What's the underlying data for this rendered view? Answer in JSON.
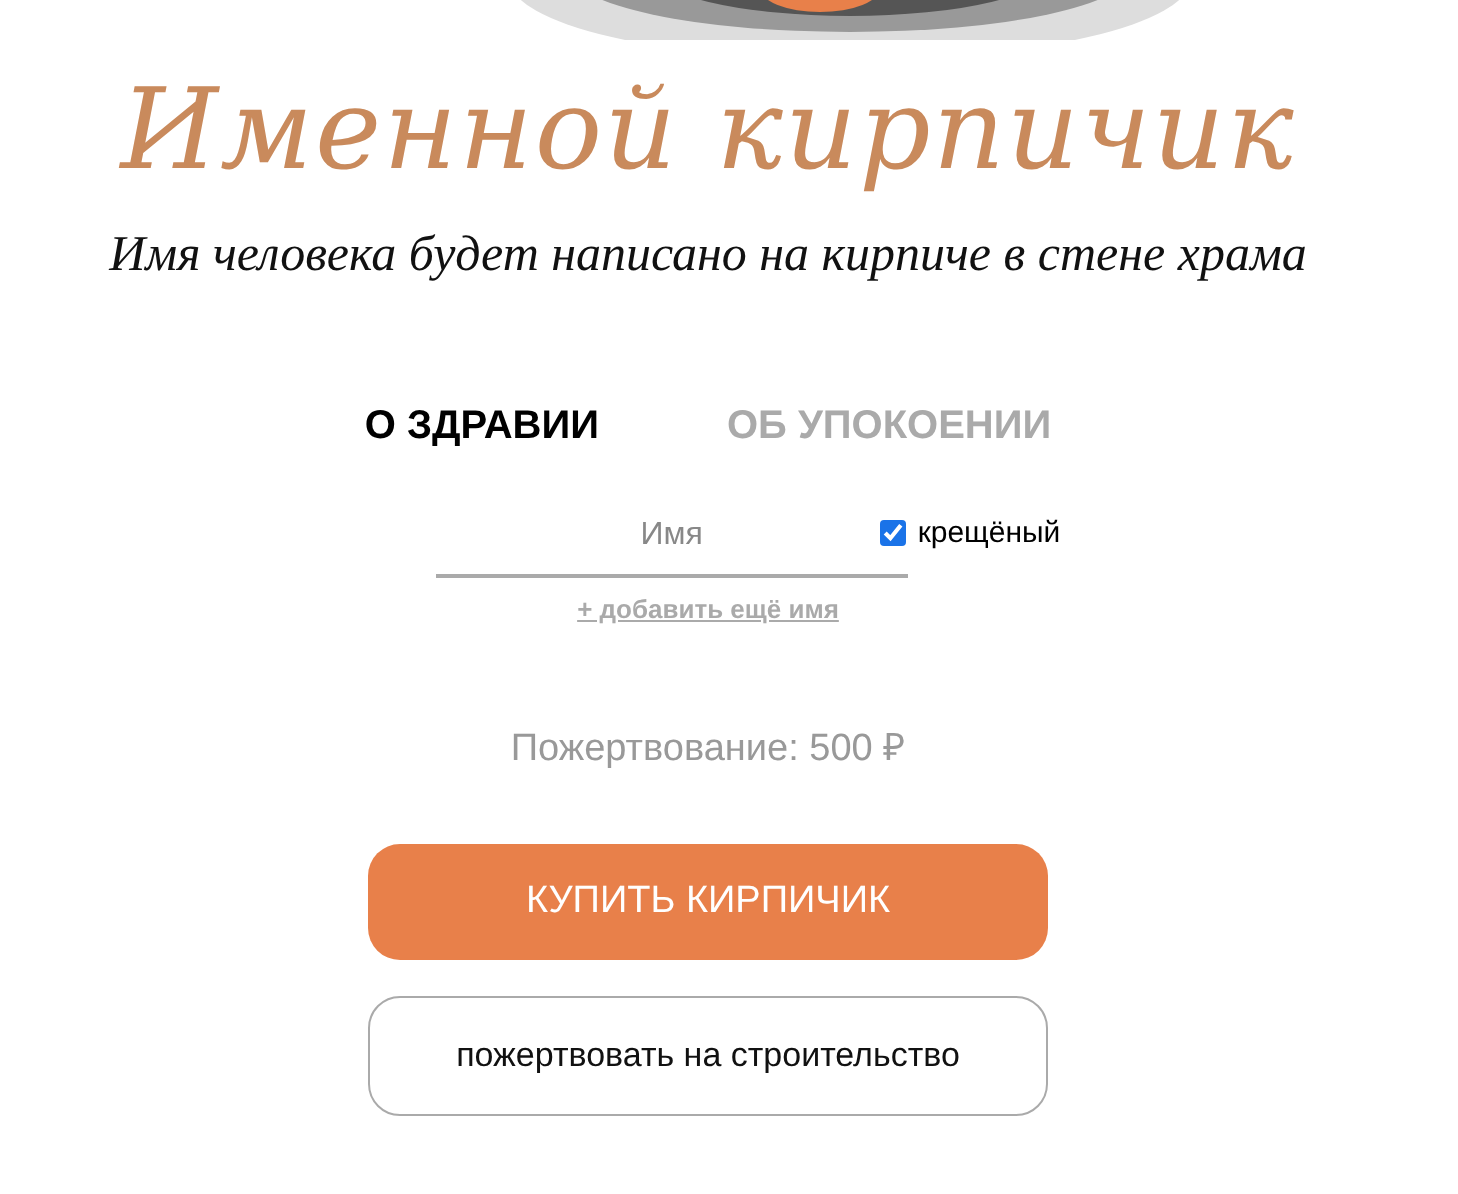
{
  "header": {
    "title": "Именной кирпичик",
    "subtitle": "Имя человека будет написано на кирпиче в стене храма"
  },
  "tabs": [
    {
      "label": "О ЗДРАВИИ",
      "selected": true
    },
    {
      "label": "ОБ УПОКОЕНИИ",
      "selected": false
    }
  ],
  "name_field": {
    "placeholder": "Имя"
  },
  "baptized": {
    "label": "крещёный",
    "checked": true
  },
  "add_name_link": "+ добавить ещё имя",
  "donation": "Пожертвование: 500 ₽",
  "buttons": [
    {
      "label": "КУПИТЬ КИРПИЧИК",
      "kind": "primary"
    },
    {
      "label": "пожертвовать на строительство",
      "kind": "outline"
    }
  ]
}
